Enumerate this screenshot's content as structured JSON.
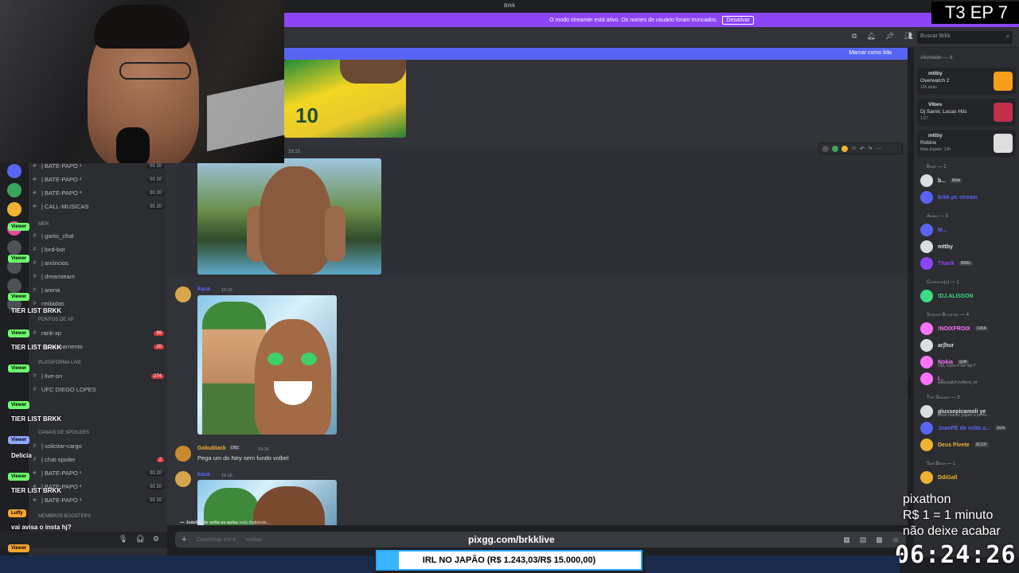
{
  "window": {
    "title": "Brkk"
  },
  "banner": {
    "text": "O modo streamer está ativo. Os nomes de usuário foram truncados.",
    "button": "Desativar"
  },
  "search": {
    "placeholder": "Buscar Brkk"
  },
  "mark_read": "Marcar como lida",
  "channels": [
    {
      "name": "| BATE-PAPO ¹",
      "icon": "speaker-icon",
      "count": "00 20"
    },
    {
      "name": "| BATE-PAPO ²",
      "icon": "speaker-icon",
      "count": "00 20"
    },
    {
      "name": "| BATE-PAPO ³",
      "icon": "speaker-icon",
      "count": "00 20"
    },
    {
      "name": "| CALL-MUSICAS",
      "icon": "speaker-icon",
      "count": "00 20"
    },
    {
      "name": "| gartic_chat",
      "icon": "hash-icon"
    },
    {
      "name": "| lord-bot",
      "icon": "hash-icon"
    },
    {
      "name": "| anúncios",
      "icon": "hash-icon"
    },
    {
      "name": "| dreamteam",
      "icon": "hash-icon"
    },
    {
      "name": "| arena",
      "icon": "hash-icon"
    },
    {
      "name": "rmitadas",
      "icon": "hash-icon"
    },
    {
      "name": "rank-xp",
      "icon": "hash-icon",
      "badge": "99"
    },
    {
      "name": "-funcionamento",
      "icon": "hash-icon",
      "badge": "20"
    },
    {
      "name": "| live-on",
      "icon": "hash-icon",
      "badge": "274"
    },
    {
      "name": "UFC DIEGO LOPES",
      "icon": "hash-icon"
    },
    {
      "name": "| solicitar-cargo",
      "icon": "hash-icon"
    },
    {
      "name": "| chat-spoiler",
      "icon": "hash-icon",
      "badge": "2"
    },
    {
      "name": "| BATE-PAPO ¹",
      "icon": "speaker-icon",
      "count": "00 20"
    },
    {
      "name": "| BATE-PAPO ²",
      "icon": "speaker-icon",
      "count": "00 20"
    },
    {
      "name": "| BATE-PAPO ³",
      "icon": "speaker-icon",
      "count": "00 20"
    }
  ],
  "categories": [
    "MER",
    "PONTOS DE XP",
    "PLATAFORMA LIVE",
    "CANAIS DE SPOILERS",
    "MEMBROS BOOSTERS"
  ],
  "overlay_chat": {
    "lines": [
      "TIER LIST BRKK",
      "TIER LIST BRKK",
      "TIER LIST BRKK",
      "Delicia",
      "TIER LIST BRKK",
      "vai avisa o insta hj?"
    ],
    "tags": [
      "Luffy"
    ]
  },
  "messages": [
    {
      "time": "19:15"
    },
    {
      "user": "kaua",
      "time": "19:15"
    },
    {
      "user": "Gokublack",
      "time": "19:16",
      "tag": "DBZ",
      "text": "Pega um  do Ney sem fundo volbel"
    },
    {
      "user": "kaua",
      "time": "19:16"
    }
  ],
  "typing": {
    "user": "JoãoPE de volta as aulas",
    "text": "está digitando..."
  },
  "composer": {
    "placeholder": "Conversar em #",
    "extra": "mídias"
  },
  "activity": {
    "header": "Atividade — 6",
    "cards": [
      {
        "user": "mttby",
        "game": "Overwatch 2",
        "time": "12h atrás",
        "color": "#f99e1a"
      },
      {
        "user": "Vibes",
        "game": "Dj Samir, Lucas Hits",
        "time": "1:07",
        "color": "#c0304a"
      },
      {
        "user": "mttby",
        "game": "Roblox",
        "time": "Mais jogado: 12h",
        "color": "#dddddd"
      }
    ]
  },
  "roles": [
    {
      "name": "Brkk — 2",
      "members": [
        {
          "name": "b...",
          "tag": "Brkk",
          "color": "#dbdee1"
        },
        {
          "name": "brkk pc stream",
          "color": "#5865f2"
        }
      ]
    },
    {
      "name": "Admin — 3",
      "members": [
        {
          "name": "M...",
          "color": "#5865f2"
        },
        {
          "name": "mttby",
          "color": "#dbdee1"
        },
        {
          "name": "Tharik",
          "tag": "BRKL",
          "color": "#8c44f7"
        }
      ]
    },
    {
      "name": "Clipador(a) — 1",
      "members": [
        {
          "name": "!DJ.ALISSON",
          "color": "#3ddc84"
        }
      ]
    },
    {
      "name": "Server Booster — 4",
      "members": [
        {
          "name": "!NOIXFROIX",
          "tag": "CRIA",
          "color": "#ff73fa"
        },
        {
          "name": "arʃhur",
          "color": "#dbdee1"
        },
        {
          "name": "Nokia",
          "tag": "goth",
          "sub": "Olá, como é ser npc?",
          "color": "#ff73fa"
        },
        {
          "name": "I...",
          "sub": "www.twitch.tv/lbron_br",
          "color": "#ff73fa"
        }
      ]
    },
    {
      "name": "Top Server — 3",
      "members": [
        {
          "name": "giussepicamoli ye",
          "sub": "jesse manoo jogam o polhe...",
          "color": "#dbdee1"
        },
        {
          "name": "JoaoPE de volta a...",
          "tag": "JoJo",
          "color": "#5865f2"
        },
        {
          "name": "Deus Pivete",
          "tag": "SCCP",
          "color": "#f0b232"
        }
      ]
    },
    {
      "name": "Sub Brkk — 1",
      "members": [
        {
          "name": "DdiGall",
          "color": "#f0b232"
        }
      ]
    }
  ],
  "stream": {
    "episode": "T3 EP 7",
    "pix_lines": [
      "pixathon",
      "R$ 1 = 1 minuto",
      "não deixe acabar"
    ],
    "clock": "06:24:26",
    "url": "pixgg.com/brkklive",
    "goal_text": "IRL NO JAPÃO (R$ 1.243,03/R$ 15.000,00)",
    "goal_fraction": 0.083
  }
}
